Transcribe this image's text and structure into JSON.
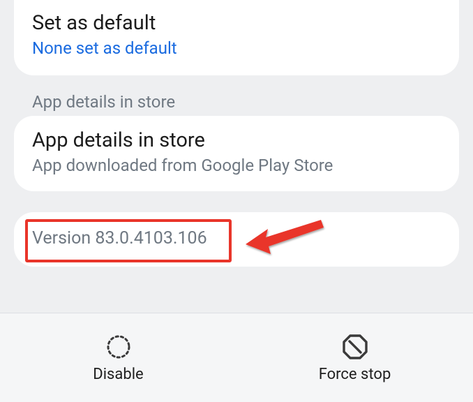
{
  "defaults": {
    "title": "Set as default",
    "subtitle": "None set as default"
  },
  "section": {
    "label": "App details in store"
  },
  "app_details": {
    "title": "App details in store",
    "subtitle": "App downloaded from Google Play Store"
  },
  "version": {
    "text": "Version 83.0.4103.106"
  },
  "actions": {
    "disable": "Disable",
    "force_stop": "Force stop"
  },
  "annotation": {
    "arrow_color": "#e9352a",
    "highlight_color": "#e9352a"
  }
}
